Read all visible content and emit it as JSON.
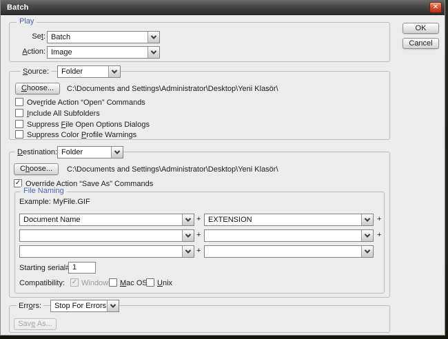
{
  "window": {
    "title": "Batch",
    "close_glyph": "✕"
  },
  "colors": {
    "accent_blue": "#4a67b0",
    "titlebar_dark": "#3a3a3a",
    "close_red": "#c63d27",
    "dialog_bg": "#ececec"
  },
  "action_buttons": {
    "ok": "OK",
    "cancel": "Cancel"
  },
  "play": {
    "legend": "Play",
    "set_label": "Se[t]:",
    "set_value": "Batch",
    "action_label": "[A]ction:",
    "action_value": "Image"
  },
  "source": {
    "label": "[S]ource:",
    "value": "Folder",
    "choose_label": "[C]hoose...",
    "path": "C:\\Documents and Settings\\Administrator\\Desktop\\Yeni Klasör\\",
    "checkboxes": [
      {
        "label": "Ove[r]ride Action “Open” Commands",
        "check": ""
      },
      {
        "label": "[I]nclude All Subfolders",
        "check": ""
      },
      {
        "label": "Suppress [F]ile Open Options Dialogs",
        "check": ""
      },
      {
        "label": "Suppress Color [P]rofile Warnings",
        "check": ""
      }
    ]
  },
  "destination": {
    "label": "[D]estination:",
    "value": "Folder",
    "choose_label": "C[h]oose...",
    "path": "C:\\Documents and Settings\\Administrator\\Desktop\\Yeni Klasör\\",
    "override_checkbox": {
      "label": "O[v]erride Action “Save As” Commands",
      "check": "✓"
    }
  },
  "file_naming": {
    "legend": "File Naming",
    "example": "Example: MyFile.GIF",
    "plus": "+",
    "rows": [
      {
        "left": "Document Name",
        "right": "EXTENSION",
        "tail": "+"
      },
      {
        "left": "",
        "right": "",
        "tail": "+"
      },
      {
        "left": "",
        "right": "",
        "tail": ""
      }
    ],
    "serial_label": "Starting serial#:",
    "serial_value": "1",
    "compatibility_label": "Compatibility:",
    "compatibility": [
      {
        "label": "Windows",
        "check": "✓"
      },
      {
        "label": "[M]ac OS",
        "check": ""
      },
      {
        "label": "[U]nix",
        "check": ""
      }
    ]
  },
  "errors": {
    "label": "Err[o]rs:",
    "value": "Stop For Errors",
    "save_as_label": "Sav[e] As..."
  }
}
